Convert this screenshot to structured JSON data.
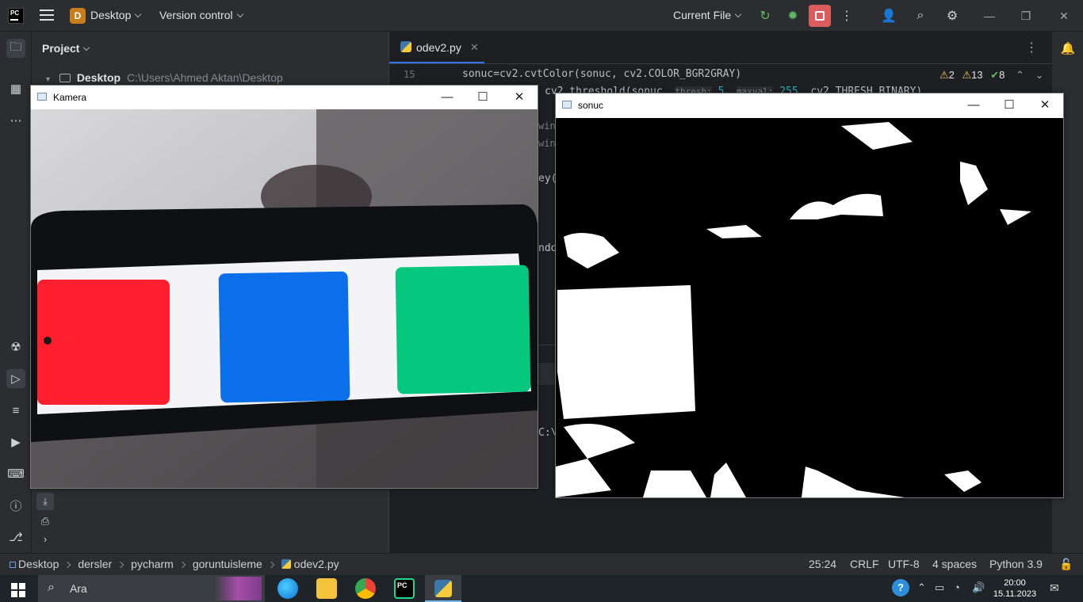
{
  "topbar": {
    "logo": "PC",
    "project_initial": "D",
    "project_name": "Desktop",
    "vcs_label": "Version control",
    "run_config": "Current File"
  },
  "project_panel": {
    "title": "Project",
    "root_name": "Desktop",
    "root_path": "C:\\Users\\Ahmed Aktan\\Desktop"
  },
  "editor": {
    "tab_name": "odev2.py",
    "line_number": "15",
    "line15": "sonuc=cv2.cvtColor(sonuc, cv2.COLOR_BGR2GRAY)",
    "line16_a": "cv2.threshold(sonuc,",
    "hint_thresh": "thresh:",
    "val_thresh": "5",
    "hint_maxval": "maxval:",
    "val_maxval": "255",
    "line16_b": "cv2.THRESH_BINARY)",
    "warn_count": "2",
    "weak_count": "13",
    "ok_count": "8",
    "frag1": "winn",
    "frag2": "winn",
    "frag3": "ey(",
    "frag4": "ndo",
    "frag5": "C:\\"
  },
  "cv_windows": {
    "camera_title": "Kamera",
    "result_title": "sonuc"
  },
  "statusbar": {
    "breadcrumbs": [
      "Desktop",
      "dersler",
      "pycharm",
      "goruntuisleme",
      "odev2.py"
    ],
    "position": "25:24",
    "line_sep": "CRLF",
    "encoding": "UTF-8",
    "indent": "4 spaces",
    "interpreter": "Python 3.9"
  },
  "taskbar": {
    "search_placeholder": "Ara",
    "time": "20:00",
    "date": "15.11.2023"
  },
  "colors": {
    "accent": "#3574f0",
    "stop": "#db5c5c",
    "red_block": "#ff1f2e",
    "blue_block": "#0a6fe8",
    "green_block": "#05c77d"
  }
}
